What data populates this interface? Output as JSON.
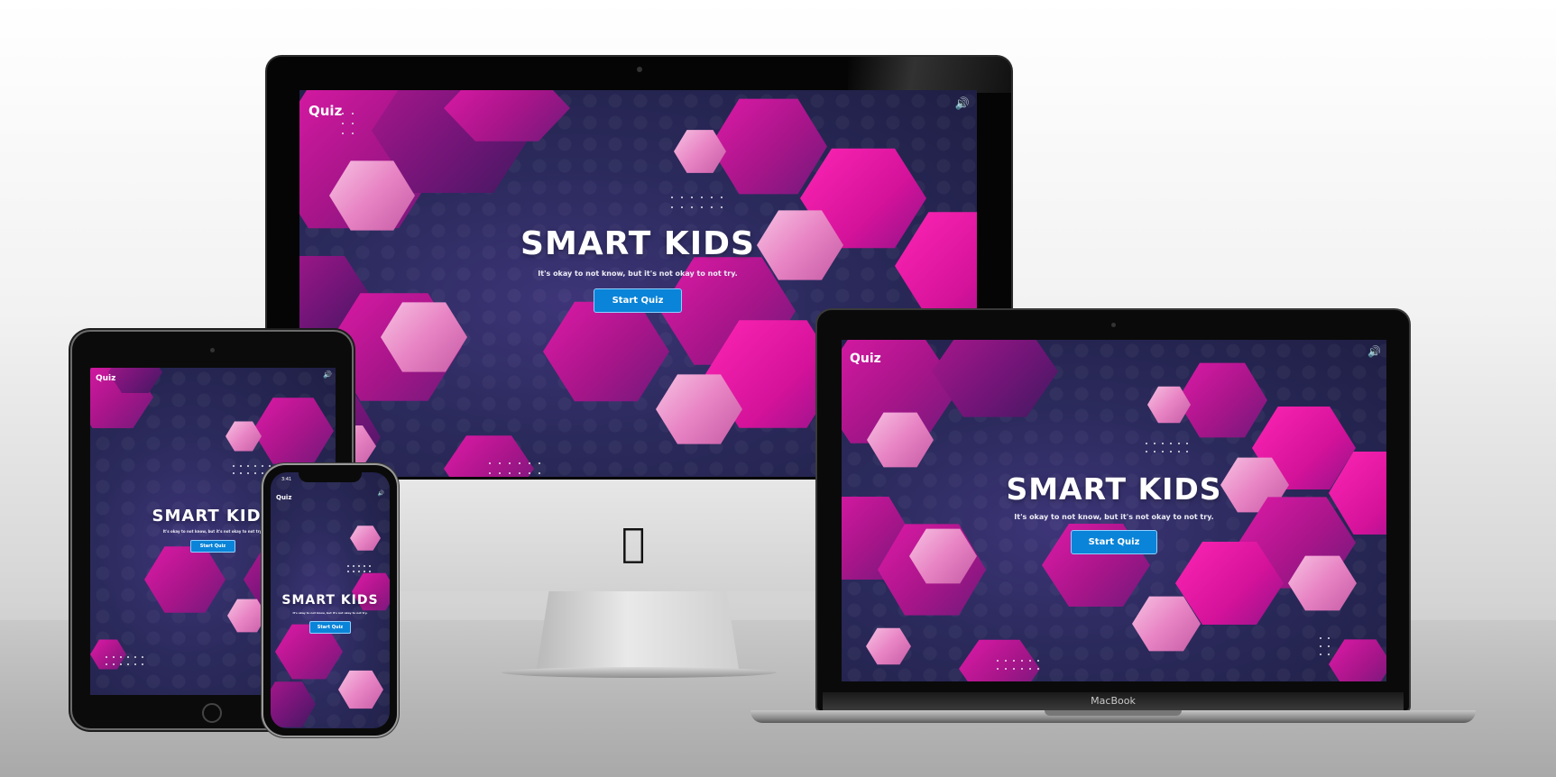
{
  "app": {
    "brand": "Quiz",
    "title": "SMART KIDS",
    "tagline": "It's okay to not know, but it's not okay to not try.",
    "start_button": "Start Quiz",
    "speaker_icon": "speaker-icon"
  },
  "devices": {
    "imac": {
      "logo_icon": "apple-logo-icon"
    },
    "macbook": {
      "label": "MacBook"
    },
    "iphone": {
      "time": "3:41"
    }
  },
  "colors": {
    "button": "#0a84d8",
    "magenta": "#e01aa8",
    "background": "#2b2a5c"
  }
}
